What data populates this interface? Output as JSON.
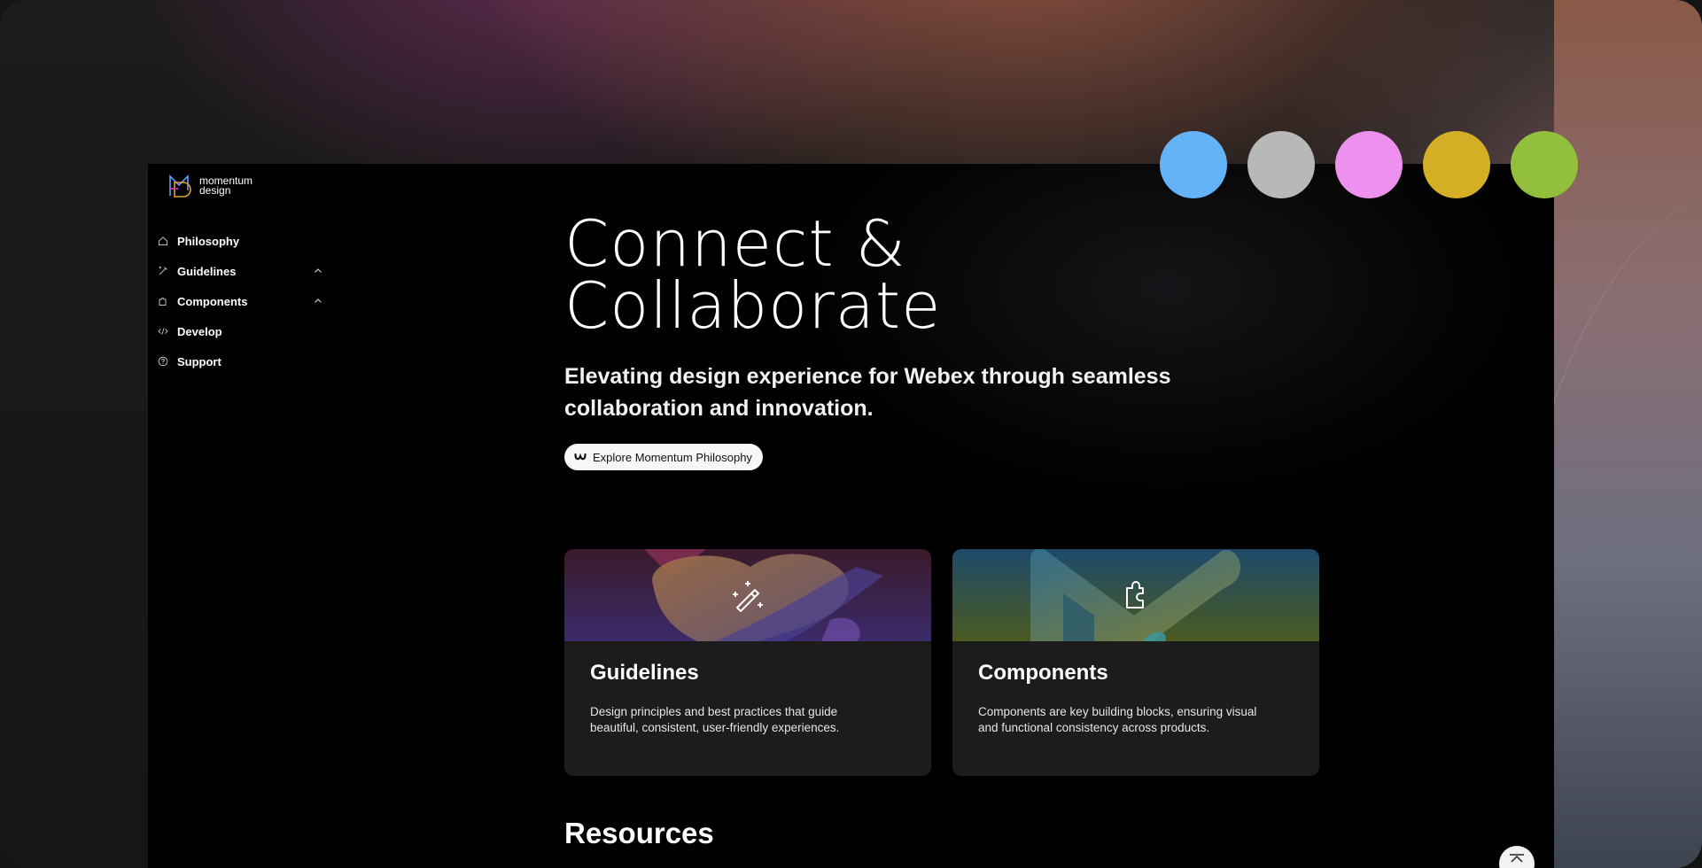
{
  "brand": {
    "name_line1": "momentum",
    "name_line2": "design"
  },
  "sidebar": {
    "items": [
      {
        "label": "Philosophy",
        "icon": "home-icon"
      },
      {
        "label": "Guidelines",
        "icon": "pen-icon",
        "expandable": true
      },
      {
        "label": "Components",
        "icon": "puzzle-icon",
        "expandable": true
      },
      {
        "label": "Develop",
        "icon": "code-icon"
      },
      {
        "label": "Support",
        "icon": "help-icon"
      }
    ]
  },
  "hero": {
    "title_line1": "Connect &",
    "title_line2": "Collaborate",
    "subtitle_line1": "Elevating design experience for Webex through seamless",
    "subtitle_line2": "collaboration and innovation.",
    "cta_label": "Explore Momentum Philosophy"
  },
  "cards": [
    {
      "title": "Guidelines",
      "description": "Design principles and best practices that guide beautiful, consistent, user-friendly experiences.",
      "icon": "magic-wand-icon"
    },
    {
      "title": "Components",
      "description": "Components are key building blocks, ensuring visual and functional consistency across products.",
      "icon": "puzzle-icon"
    }
  ],
  "resources_heading": "Resources",
  "theme_colors": [
    "#64b3f6",
    "#b8b8b8",
    "#ee90ee",
    "#d4ae24",
    "#93c03c"
  ]
}
